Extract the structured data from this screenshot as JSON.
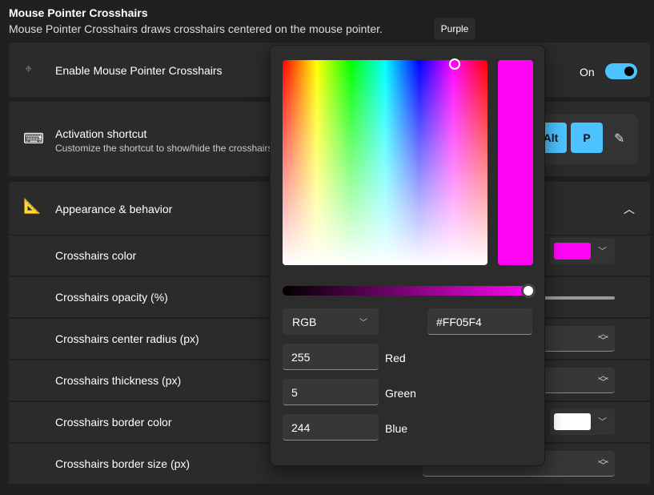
{
  "header": {
    "title": "Mouse Pointer Crosshairs",
    "description": "Mouse Pointer Crosshairs draws crosshairs centered on the mouse pointer."
  },
  "enable": {
    "label": "Enable Mouse Pointer Crosshairs",
    "state_label": "On",
    "on": true,
    "icon": "crosshair-icon"
  },
  "shortcut": {
    "title": "Activation shortcut",
    "description": "Customize the shortcut to show/hide the crosshairs",
    "keys": [
      "Alt",
      "P"
    ],
    "icon": "keyboard-icon"
  },
  "appearance": {
    "title": "Appearance & behavior",
    "icon": "ruler-icon",
    "expanded": true
  },
  "settings": [
    {
      "label": "Crosshairs color",
      "type": "color",
      "color": "#FF05F4"
    },
    {
      "label": "Crosshairs opacity (%)",
      "type": "slider"
    },
    {
      "label": "Crosshairs center radius (px)",
      "type": "number"
    },
    {
      "label": "Crosshairs thickness (px)",
      "type": "number"
    },
    {
      "label": "Crosshairs border color",
      "type": "color",
      "color": "#FFFFFF"
    },
    {
      "label": "Crosshairs border size (px)",
      "type": "number"
    }
  ],
  "tooltip": "Purple",
  "picker": {
    "mode": "RGB",
    "hex": "#FF05F4",
    "alpha": 1.0,
    "channels": [
      {
        "value": "255",
        "label": "Red"
      },
      {
        "value": "5",
        "label": "Green"
      },
      {
        "value": "244",
        "label": "Blue"
      }
    ],
    "selected_color": "#FF05F4",
    "accent": "#4cc2ff"
  }
}
